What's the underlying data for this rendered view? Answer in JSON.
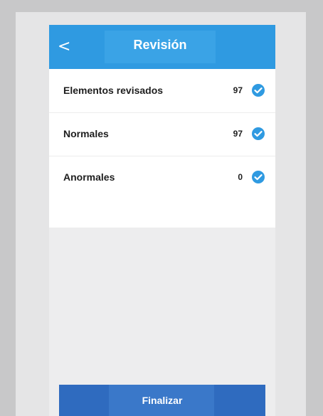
{
  "header": {
    "title": "Revisión",
    "back_icon": "<"
  },
  "rows": [
    {
      "label": "Elementos revisados",
      "count": "97",
      "icon": "check-circle-icon"
    },
    {
      "label": "Normales",
      "count": "97",
      "icon": "check-circle-icon"
    },
    {
      "label": "Anormales",
      "count": "0",
      "icon": "check-circle-icon"
    }
  ],
  "footer": {
    "button_label": "Finalizar"
  },
  "colors": {
    "header": "#2f9ae1",
    "check": "#2f9ae1",
    "button": "#2f6bbf",
    "background": "#ededee"
  }
}
